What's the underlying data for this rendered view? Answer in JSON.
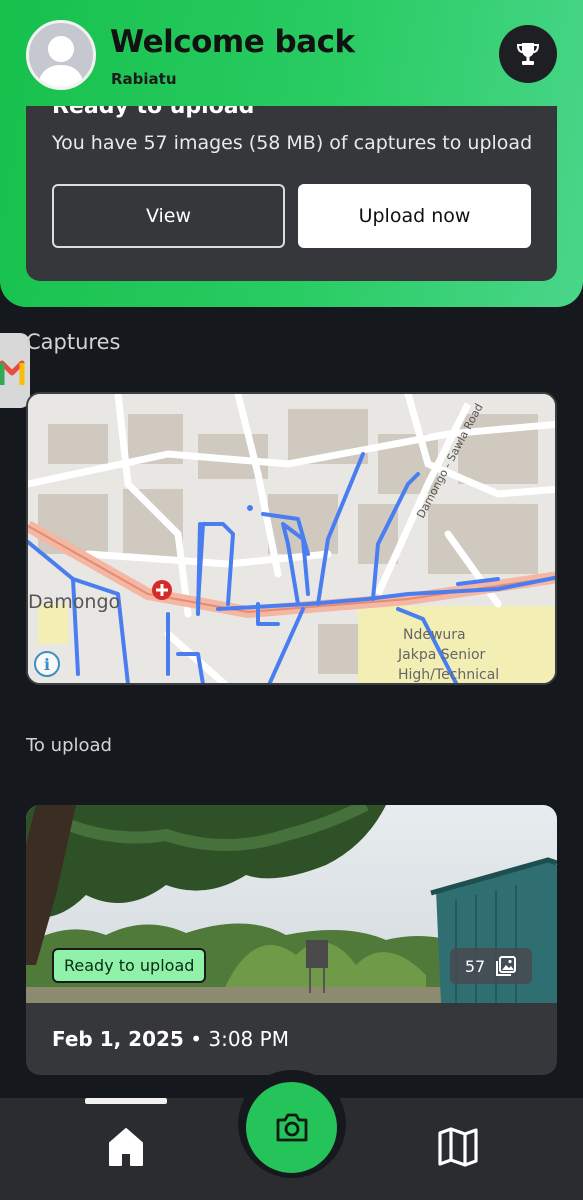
{
  "header": {
    "welcome": "Welcome back",
    "username": "Rabiatu",
    "avatar_icon": "user-avatar-icon",
    "trophy_icon": "trophy-icon"
  },
  "upload_card": {
    "title": "Ready to upload",
    "description": "You have 57 images (58 MB) of captures to upload",
    "view_label": "View",
    "upload_label": "Upload now"
  },
  "sections": {
    "captures": "Captures",
    "to_upload": "To upload"
  },
  "map": {
    "labels": [
      "Damongo",
      "Damongo - Sawla Road",
      "Ndewura Jakpa Senior High/Technical"
    ],
    "info_icon": "i"
  },
  "capture": {
    "status": "Ready to upload",
    "image_count": "57",
    "date": "Feb 1, 2025",
    "separator": " • ",
    "time": "3:08 PM"
  },
  "nav": {
    "home_icon": "home-icon",
    "camera_icon": "camera-icon",
    "map_icon": "map-icon"
  },
  "colors": {
    "accent_green": "#24c45a",
    "card_bg": "#35373b",
    "page_bg": "#15181d",
    "track_blue": "#4a7ef0",
    "badge_green": "#8ff2a8"
  }
}
